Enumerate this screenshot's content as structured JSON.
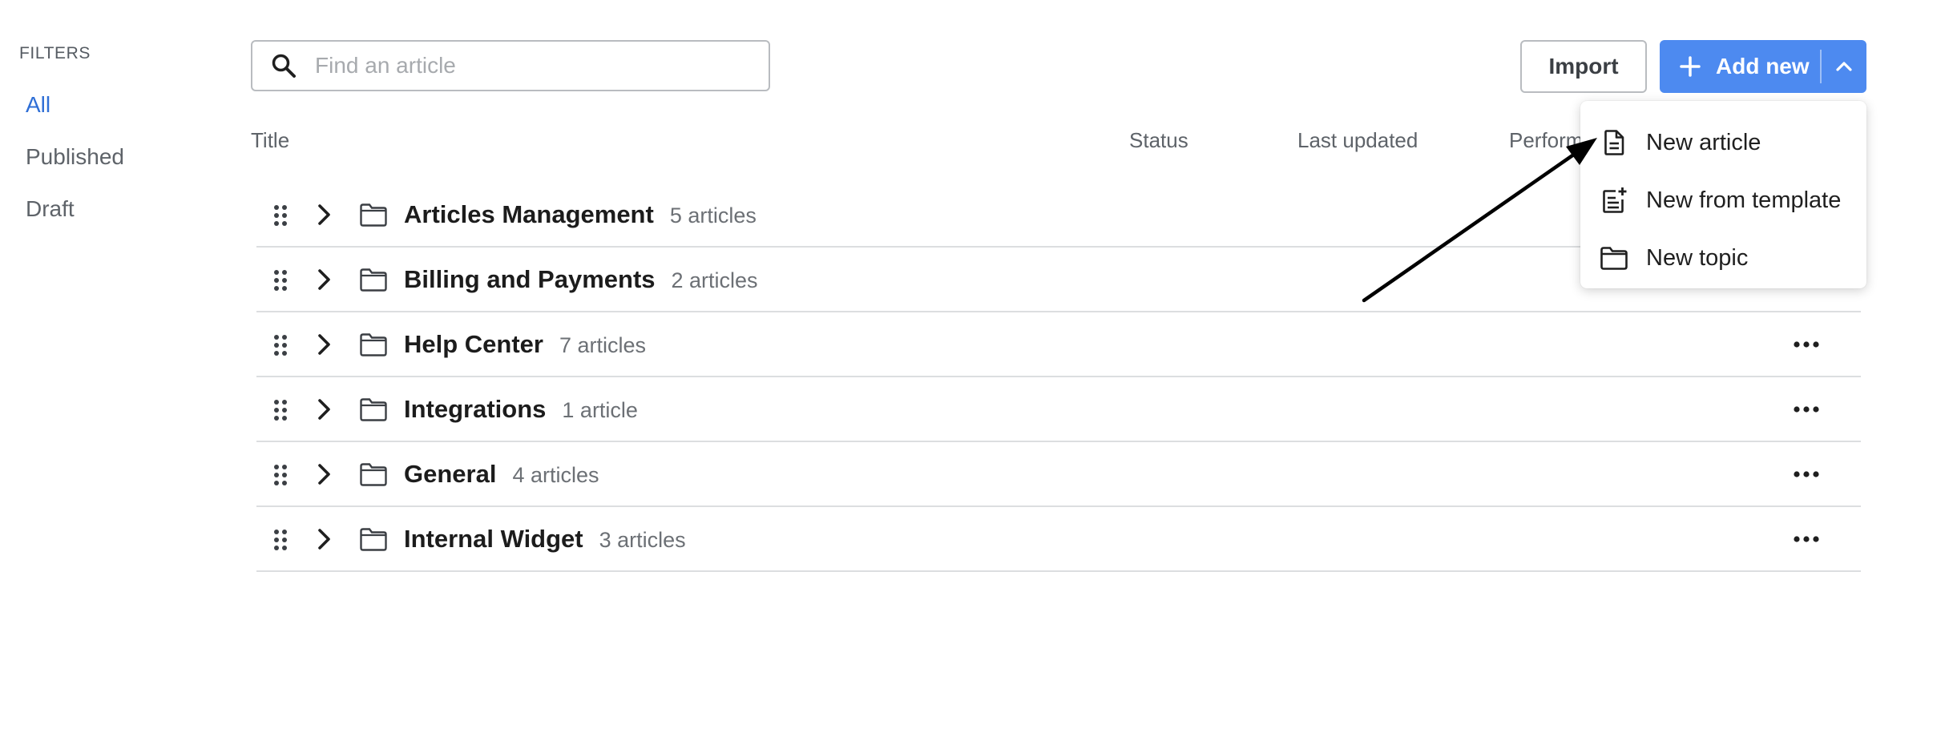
{
  "sidebar": {
    "heading": "FILTERS",
    "items": [
      {
        "label": "All",
        "active": true
      },
      {
        "label": "Published",
        "active": false
      },
      {
        "label": "Draft",
        "active": false
      }
    ]
  },
  "search": {
    "placeholder": "Find an article",
    "value": "",
    "icon": "search-icon"
  },
  "toolbar": {
    "import_label": "Import",
    "add_new_label": "Add new",
    "add_new_color": "#4d8af0"
  },
  "dropdown": {
    "items": [
      {
        "label": "New article",
        "icon": "document-icon"
      },
      {
        "label": "New from template",
        "icon": "template-icon"
      },
      {
        "label": "New topic",
        "icon": "folder-icon"
      }
    ]
  },
  "table": {
    "columns": [
      "Title",
      "Status",
      "Last updated",
      "Perform"
    ],
    "rows": [
      {
        "title": "Articles Management",
        "count": "5 articles"
      },
      {
        "title": "Billing and Payments",
        "count": "2 articles"
      },
      {
        "title": "Help Center",
        "count": "7 articles"
      },
      {
        "title": "Integrations",
        "count": "1 article"
      },
      {
        "title": "General",
        "count": "4 articles"
      },
      {
        "title": "Internal Widget",
        "count": "3 articles"
      }
    ]
  },
  "colors": {
    "accent": "#4d8af0",
    "active_filter": "#2f6fd6"
  }
}
